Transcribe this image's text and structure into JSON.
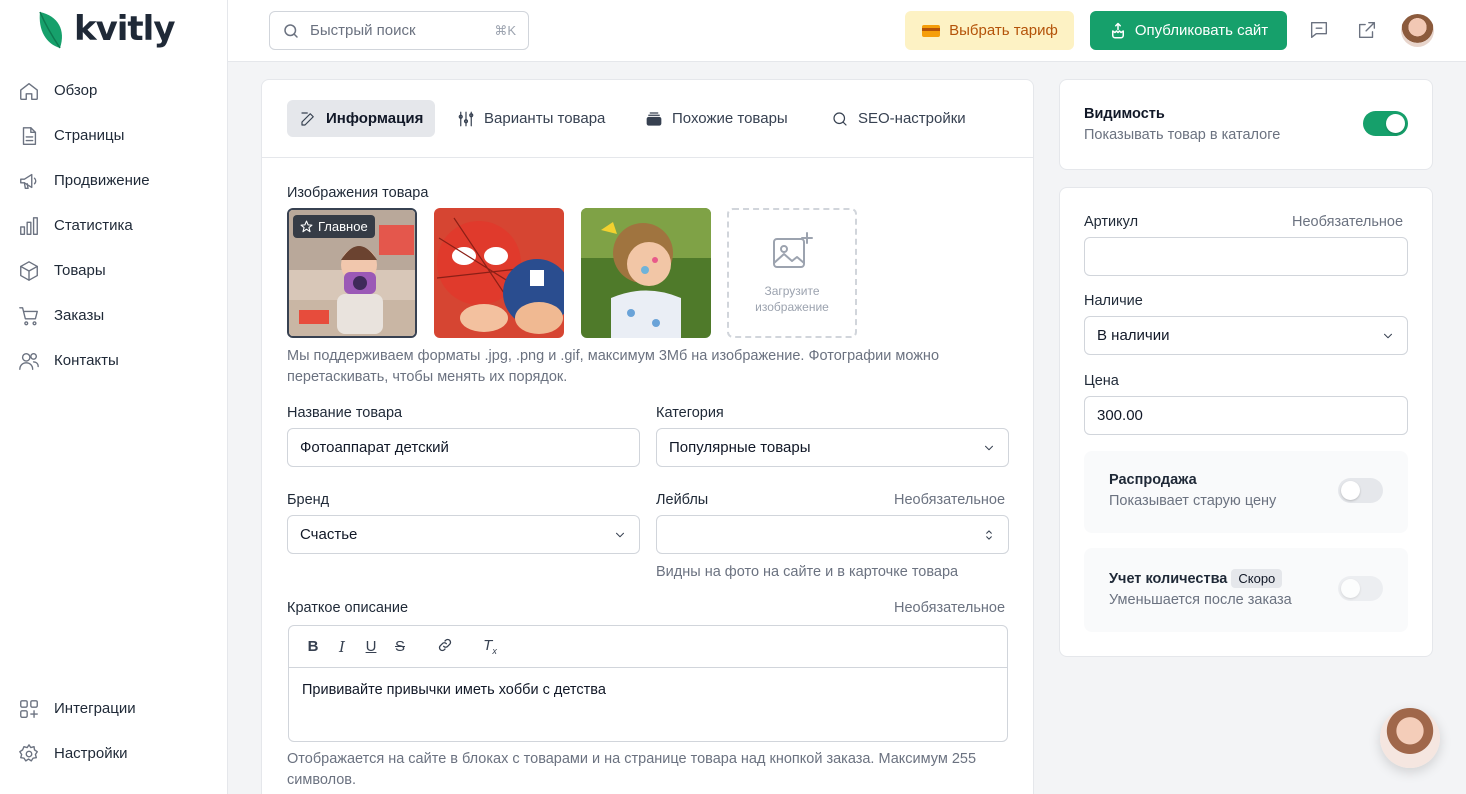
{
  "brand": {
    "name": "kvitly",
    "accent": "#16a06b"
  },
  "sidebar": {
    "items": [
      {
        "label": "Обзор",
        "icon": "home-icon"
      },
      {
        "label": "Страницы",
        "icon": "document-icon"
      },
      {
        "label": "Продвижение",
        "icon": "megaphone-icon"
      },
      {
        "label": "Статистика",
        "icon": "bar-chart-icon"
      },
      {
        "label": "Товары",
        "icon": "box-icon"
      },
      {
        "label": "Заказы",
        "icon": "cart-icon"
      },
      {
        "label": "Контакты",
        "icon": "users-icon"
      }
    ],
    "bottom": [
      {
        "label": "Интеграции",
        "icon": "grid-plus-icon"
      },
      {
        "label": "Настройки",
        "icon": "gear-icon"
      }
    ]
  },
  "topbar": {
    "search_placeholder": "Быстрый поиск",
    "search_shortcut": "⌘K",
    "tariff_label": "Выбрать тариф",
    "publish_label": "Опубликовать сайт"
  },
  "tabs": [
    "Информация",
    "Варианты товара",
    "Похожие товары",
    "SEO-настройки"
  ],
  "images": {
    "label": "Изображения товара",
    "main_badge": "Главное",
    "upload_label": "Загрузите изображение",
    "hint": "Мы поддерживаем форматы .jpg, .png и .gif, максимум 3Мб на изображение. Фотографии можно перетаскивать, чтобы менять их порядок."
  },
  "form": {
    "name_label": "Название товара",
    "name_value": "Фотоаппарат детский",
    "category_label": "Категория",
    "category_value": "Популярные товары",
    "brand_label": "Бренд",
    "brand_value": "Счастье",
    "labels_label": "Лейблы",
    "optional": "Необязательное",
    "labels_hint": "Видны на фото на сайте и в карточке товара",
    "short_desc_label": "Краткое описание",
    "short_desc_value": "Прививайте привычки иметь хобби с детства",
    "short_desc_hint": "Отображается на сайте в блоках с товарами и на странице товара над кнопкой заказа. Максимум 255 символов."
  },
  "visibility": {
    "title": "Видимость",
    "subtitle": "Показывать товар в каталоге",
    "enabled": true
  },
  "props": {
    "sku_label": "Артикул",
    "sku_optional": "Необязательное",
    "sku_value": "",
    "stock_label": "Наличие",
    "stock_value": "В наличии",
    "price_label": "Цена",
    "price_value": "300.00",
    "sale_title": "Распродажа",
    "sale_subtitle": "Показывает старую цену",
    "sale_enabled": false,
    "qty_title": "Учет количества",
    "qty_badge": "Скоро",
    "qty_subtitle": "Уменьшается после заказа",
    "qty_enabled": false
  }
}
